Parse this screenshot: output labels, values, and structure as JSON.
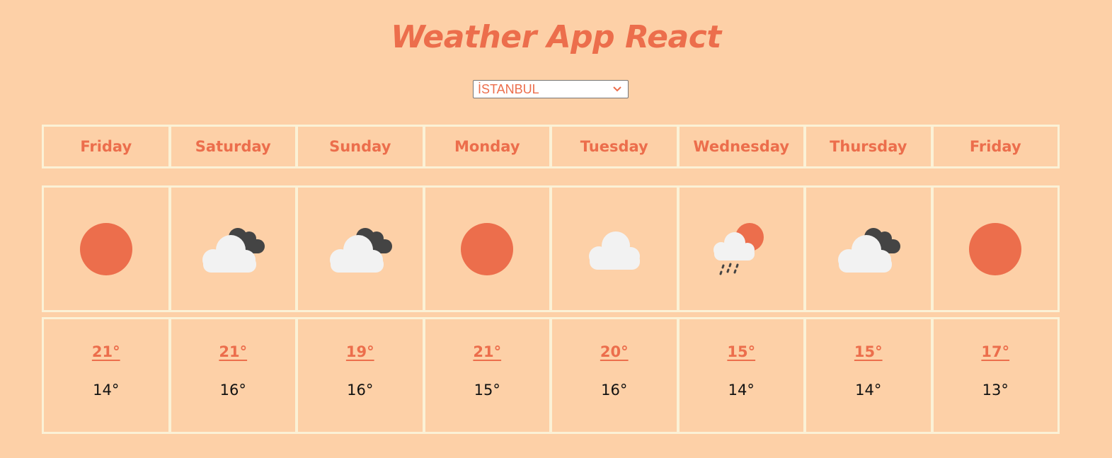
{
  "app": {
    "title": "Weather App React"
  },
  "city_select": {
    "value": "İSTANBUL"
  },
  "colors": {
    "background": "#FDD0A7",
    "accent": "#EC6E4C",
    "border": "#FBF1D6",
    "cloud_light": "#F2F2F2",
    "cloud_dark": "#444444"
  },
  "forecast": [
    {
      "day": "Friday",
      "icon": "sun-icon",
      "max": "21°",
      "min": "14°"
    },
    {
      "day": "Saturday",
      "icon": "cloudy-icon",
      "max": "21°",
      "min": "16°"
    },
    {
      "day": "Sunday",
      "icon": "cloudy-icon",
      "max": "19°",
      "min": "16°"
    },
    {
      "day": "Monday",
      "icon": "sun-icon",
      "max": "21°",
      "min": "15°"
    },
    {
      "day": "Tuesday",
      "icon": "cloud-icon",
      "max": "20°",
      "min": "16°"
    },
    {
      "day": "Wednesday",
      "icon": "rain-sun-icon",
      "max": "15°",
      "min": "14°"
    },
    {
      "day": "Thursday",
      "icon": "cloudy-icon",
      "max": "15°",
      "min": "14°"
    },
    {
      "day": "Friday",
      "icon": "sun-icon",
      "max": "17°",
      "min": "13°"
    }
  ]
}
